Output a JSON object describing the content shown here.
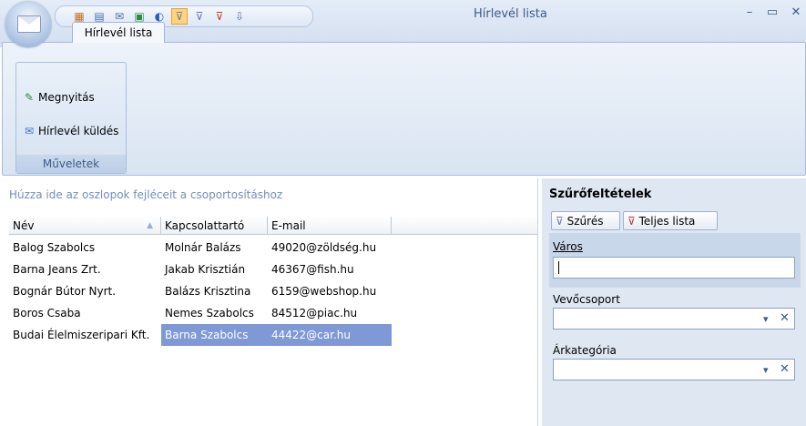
{
  "window": {
    "title": "Hírlevél lista",
    "minimize_label": "–",
    "maximize_label": "▭",
    "close_label": "✕"
  },
  "quick_access": {
    "icons": [
      "grid-icon",
      "table-icon",
      "mail-icon",
      "excel-icon",
      "chart-icon",
      "filter-icon",
      "filter-add-icon",
      "filter-clear-icon",
      "export-icon"
    ],
    "active_icon": "filter-icon"
  },
  "ribbon": {
    "tab_label": "Hírlevél lista",
    "group_label": "Műveletek",
    "open_label": "Megnyitás",
    "send_label": "Hírlevél küldés"
  },
  "grid": {
    "group_hint": "Húzza ide az oszlopok fejléceit a csoportosításhoz",
    "columns": [
      "Név",
      "Kapcsolattartó",
      "E-mail"
    ],
    "rows": [
      [
        "Balog Szabolcs",
        "Molnár Balázs",
        "49020@zöldség.hu"
      ],
      [
        "Barna Jeans Zrt.",
        "Jakab Krisztián",
        "46367@fish.hu"
      ],
      [
        "Bognár Bútor Nyrt.",
        "Balázs Krisztina",
        "6159@webshop.hu"
      ],
      [
        "Boros Csaba",
        "Nemes Szabolcs",
        "84512@piac.hu"
      ],
      [
        "Budai Élelmiszeripari Kft.",
        "Barna Szabolcs",
        "44422@car.hu"
      ]
    ],
    "selected_row": 4
  },
  "filter_panel": {
    "title": "Szűrőfeltételek",
    "filter_button": "Szűrés",
    "full_list_button": "Teljes lista",
    "city_label": "Város",
    "city_value": "",
    "customer_group_label": "Vevőcsoport",
    "customer_group_value": "",
    "price_category_label": "Árkategória",
    "price_category_value": "",
    "dropdown_glyph": "▾",
    "clear_glyph": "✕"
  },
  "colors": {
    "accent": "#3b5b8a",
    "selection": "#7f98d6",
    "panel_bg": "#dfe7f3"
  }
}
